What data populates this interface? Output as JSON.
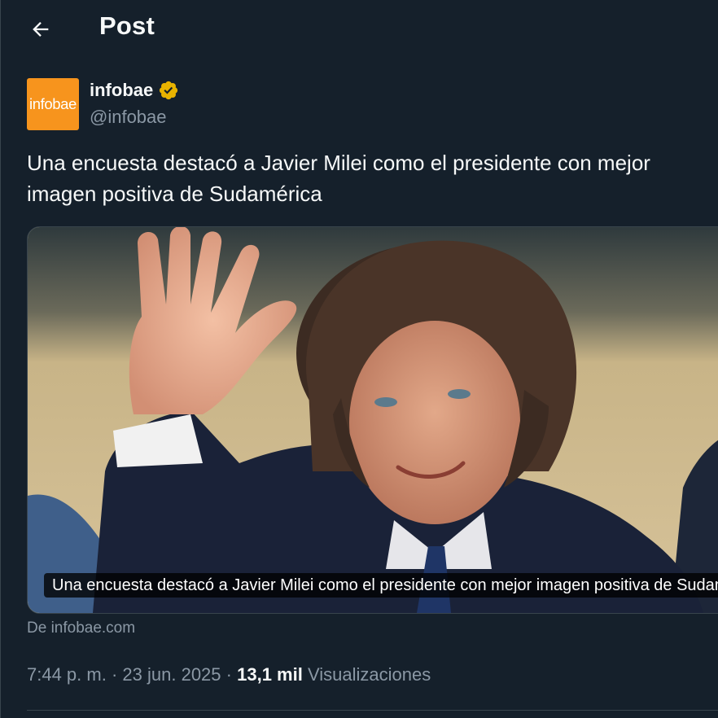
{
  "header": {
    "title": "Post",
    "back_icon": "arrow-left-icon"
  },
  "author": {
    "avatar_text": "infobae",
    "avatar_color": "#f7941d",
    "name": "infobae",
    "handle": "@infobae",
    "verified_icon": "verified-badge-icon",
    "verified_color": "#e8b300"
  },
  "tweet": {
    "text": "Una encuesta destacó a Javier Milei como el presidente con mejor imagen positiva de Sudamérica"
  },
  "media": {
    "caption": "Una encuesta destacó a Javier Milei como el presidente con mejor imagen positiva de Sudamérica",
    "source": "De infobae.com"
  },
  "meta": {
    "time": "7:44 p. m.",
    "separator": "·",
    "date": "23 jun. 2025",
    "views_count": "13,1 mil",
    "views_label": "Visualizaciones"
  },
  "colors": {
    "background": "#15202b",
    "text_primary": "#f7f9f9",
    "text_secondary": "#8b98a5",
    "border": "#38444d"
  }
}
